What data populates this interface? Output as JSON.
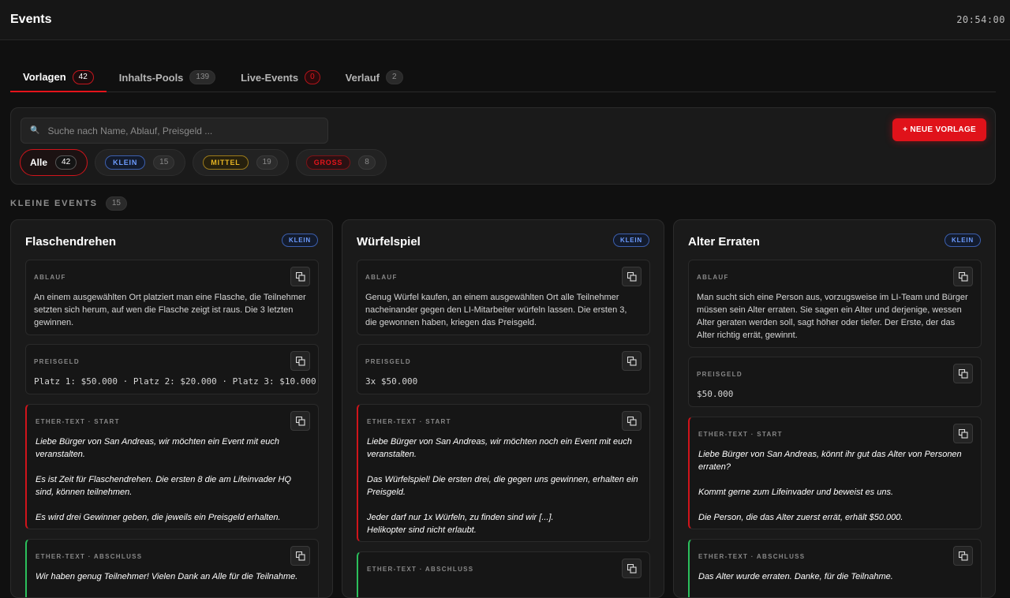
{
  "header": {
    "title": "Events",
    "clock": "20:54:00"
  },
  "tabs": [
    {
      "label": "Vorlagen",
      "count": "42"
    },
    {
      "label": "Inhalts-Pools",
      "count": "139"
    },
    {
      "label": "Live-Events",
      "count": "0"
    },
    {
      "label": "Verlauf",
      "count": "2"
    }
  ],
  "search": {
    "placeholder": "Suche nach Name, Ablauf, Preisgeld ..."
  },
  "new_button": {
    "label": "+ NEUE VORLAGE"
  },
  "filters": [
    {
      "label": "Alle",
      "count": "42"
    },
    {
      "label": "KLEIN",
      "count": "15"
    },
    {
      "label": "MITTEL",
      "count": "19"
    },
    {
      "label": "GROSS",
      "count": "8"
    }
  ],
  "section": {
    "title": "KLEINE EVENTS",
    "count": "15"
  },
  "labels": {
    "ablauf": "ABLAUF",
    "preisgeld": "PREISGELD",
    "ether_start": "ETHER-TEXT · START",
    "ether_end": "ETHER-TEXT · ABSCHLUSS"
  },
  "cards": [
    {
      "title": "Flaschendrehen",
      "badge": "KLEIN",
      "ablauf": "An einem ausgewählten Ort platziert man eine Flasche, die Teilnehmer setzten sich herum, auf wen die Flasche zeigt ist raus. Die 3 letzten gewinnen.",
      "preisgeld": "Platz 1: $50.000 · Platz 2: $20.000 · Platz 3: $10.000",
      "ether_start": "Liebe Bürger von San Andreas, wir möchten ein Event mit euch veranstalten.\n\nEs ist Zeit für Flaschendrehen. Die ersten 8 die am Lifeinvader HQ sind, können teilnehmen.\n\nEs wird drei Gewinner geben, die jeweils ein Preisgeld erhalten.",
      "ether_end": "Wir haben genug Teilnehmer! Vielen Dank an Alle für die Teilnahme."
    },
    {
      "title": "Würfelspiel",
      "badge": "KLEIN",
      "ablauf": "Genug Würfel kaufen, an einem ausgewählten Ort alle Teilnehmer nacheinander gegen den LI-Mitarbeiter würfeln lassen. Die ersten 3, die gewonnen haben, kriegen das Preisgeld.",
      "preisgeld": "3x $50.000",
      "ether_start": "Liebe Bürger von San Andreas, wir möchten noch ein Event mit euch veranstalten.\n\nDas Würfelspiel! Die ersten drei, die gegen uns gewinnen, erhalten ein Preisgeld.\n\nJeder darf nur 1x Würfeln, zu finden sind wir [...].\nHelikopter sind nicht erlaubt.",
      "ether_end": ""
    },
    {
      "title": "Alter Erraten",
      "badge": "KLEIN",
      "ablauf": "Man sucht sich eine Person aus, vorzugsweise im LI-Team und Bürger müssen sein Alter erraten. Sie sagen ein Alter und derjenige, wessen Alter geraten werden soll, sagt höher oder tiefer. Der Erste, der das Alter richtig errät, gewinnt.",
      "preisgeld": "$50.000",
      "ether_start": "Liebe Bürger von San Andreas, könnt ihr gut das Alter von Personen erraten?\n\nKommt gerne zum Lifeinvader und beweist es uns.\n\nDie Person, die das Alter zuerst errät, erhält $50.000.",
      "ether_end": "Das Alter wurde erraten. Danke, für die Teilnahme."
    }
  ]
}
